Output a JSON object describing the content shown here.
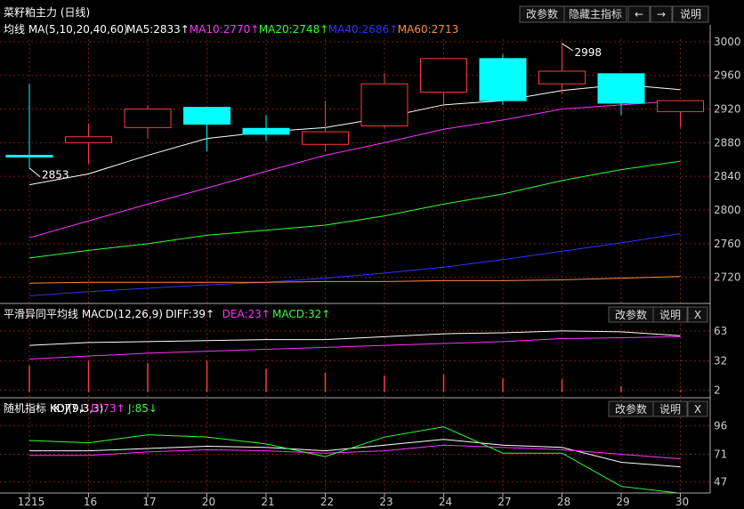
{
  "window_title": "菜籽粕主力 (日线)",
  "toolbar": {
    "change_params": "改参数",
    "hide_main_indicator": "隐藏主指标",
    "left_arrow": "←",
    "right_arrow": "→",
    "explain": "说明",
    "close": "X"
  },
  "colors": {
    "up": "#ff3c3c",
    "down": "#00ffff",
    "ma5": "#ffffff",
    "ma10": "#ff33ff",
    "ma20": "#33ff33",
    "ma40": "#3333ff",
    "ma60": "#ff8844",
    "grid": "#7a1a1a"
  },
  "chart_data": [
    {
      "type": "candlestick",
      "title": "均线 MA(5,10,20,40,60)",
      "legend": [
        {
          "name": "MA5:2833↑",
          "color": "#ffffff"
        },
        {
          "name": "MA10:2770↑",
          "color": "#ff33ff"
        },
        {
          "name": "MA20:2748↑",
          "color": "#33ff33"
        },
        {
          "name": "MA40:2686↑",
          "color": "#3333ff"
        },
        {
          "name": "MA60:2713",
          "color": "#ff8844"
        }
      ],
      "dates": [
        "1215",
        "16",
        "17",
        "20",
        "21",
        "22",
        "23",
        "24",
        "27",
        "28",
        "29",
        "30"
      ],
      "ohlc": [
        [
          2865,
          2950,
          2850,
          2863
        ],
        [
          2880,
          2903,
          2855,
          2887
        ],
        [
          2898,
          2925,
          2885,
          2920
        ],
        [
          2922,
          2922,
          2870,
          2902
        ],
        [
          2897,
          2913,
          2882,
          2890
        ],
        [
          2878,
          2930,
          2870,
          2893
        ],
        [
          2900,
          2963,
          2897,
          2950
        ],
        [
          2940,
          2980,
          2925,
          2980
        ],
        [
          2980,
          2985,
          2925,
          2930
        ],
        [
          2950,
          2998,
          2938,
          2965
        ],
        [
          2962,
          2962,
          2913,
          2927
        ],
        [
          2917,
          2930,
          2898,
          2930
        ]
      ],
      "ma_series": [
        {
          "name": "MA5",
          "values": [
            2830,
            2843,
            2865,
            2885,
            2893,
            2898,
            2910,
            2925,
            2930,
            2942,
            2949,
            2943
          ]
        },
        {
          "name": "MA10",
          "values": [
            2767,
            2787,
            2807,
            2826,
            2846,
            2865,
            2880,
            2896,
            2907,
            2920,
            2925,
            2930
          ]
        },
        {
          "name": "MA20",
          "values": [
            2743,
            2752,
            2760,
            2770,
            2776,
            2782,
            2793,
            2807,
            2819,
            2835,
            2848,
            2858
          ]
        },
        {
          "name": "MA40",
          "values": [
            2698,
            2703,
            2707,
            2711,
            2714,
            2719,
            2725,
            2732,
            2741,
            2751,
            2761,
            2772
          ]
        },
        {
          "name": "MA60",
          "values": [
            2713,
            2714,
            2714,
            2714,
            2714,
            2715,
            2715,
            2716,
            2716,
            2717,
            2719,
            2721
          ]
        }
      ],
      "annotations": [
        {
          "text": "2853"
        },
        {
          "text": "2998"
        }
      ],
      "y_ticks": [
        2720,
        2760,
        2800,
        2840,
        2880,
        2920,
        2960,
        3000
      ],
      "ylim": [
        2690,
        3020
      ]
    },
    {
      "type": "macd",
      "title": "平滑异同平均线 MACD(12,26,9)",
      "legend": [
        {
          "name": "DIFF:39↑",
          "color": "#ffffff"
        },
        {
          "name": "DEA:23↑",
          "color": "#ff33ff"
        },
        {
          "name": "MACD:32↑",
          "color": "#33ff33"
        }
      ],
      "diff": [
        48,
        51,
        52,
        53,
        54,
        54,
        57,
        60,
        61,
        63,
        62,
        58
      ],
      "dea": [
        34,
        37,
        40,
        42,
        44,
        46,
        48,
        50,
        52,
        55,
        56,
        57
      ],
      "macd_bars": [
        27,
        32,
        30,
        32,
        24,
        20,
        17,
        18,
        14,
        13,
        6,
        2
      ],
      "y_ticks": [
        2,
        32,
        63
      ],
      "ylim": [
        -5,
        72
      ]
    },
    {
      "type": "kdj",
      "title": "随机指标 KDJ(9,3,3)",
      "legend": [
        {
          "name": "K:77↓",
          "color": "#ffffff"
        },
        {
          "name": "D:73↑",
          "color": "#ff33ff"
        },
        {
          "name": "J:85↓",
          "color": "#33ff33"
        }
      ],
      "k": [
        74,
        74,
        76,
        78,
        77,
        74,
        79,
        84,
        79,
        77,
        64,
        60
      ],
      "d": [
        70,
        70,
        73,
        75,
        74,
        72,
        74,
        79,
        77,
        75,
        71,
        67
      ],
      "j": [
        83,
        81,
        88,
        86,
        80,
        69,
        86,
        95,
        72,
        72,
        43,
        37
      ],
      "y_ticks": [
        47,
        71,
        96
      ],
      "ylim": [
        38,
        104
      ]
    }
  ]
}
